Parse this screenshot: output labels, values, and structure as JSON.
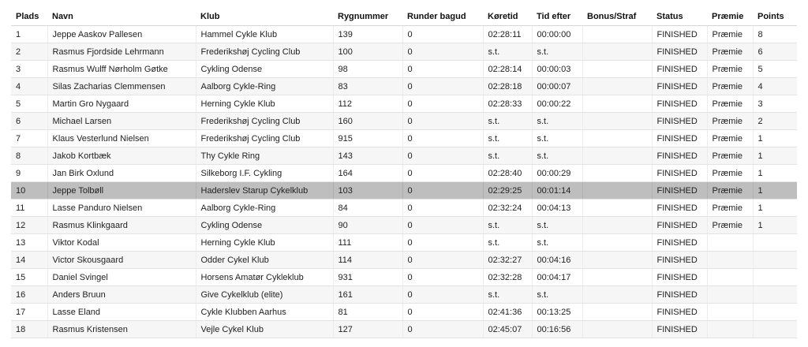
{
  "colors": {
    "highlight_row": "#bebebe",
    "stripe_row": "#f6f6f6",
    "border": "#e4e4e4"
  },
  "highlighted_rank": "10",
  "table": {
    "columns": [
      "Plads",
      "Navn",
      "Klub",
      "Rygnummer",
      "Runder bagud",
      "Køretid",
      "Tid efter",
      "Bonus/Straf",
      "Status",
      "Præmie",
      "Points"
    ],
    "rows": [
      [
        "1",
        "Jeppe Aaskov Pallesen",
        "Hammel Cykle Klub",
        "139",
        "0",
        "02:28:11",
        "00:00:00",
        "",
        "FINISHED",
        "Præmie",
        "8"
      ],
      [
        "2",
        "Rasmus Fjordside Lehrmann",
        "Frederikshøj Cycling Club",
        "100",
        "0",
        "s.t.",
        "s.t.",
        "",
        "FINISHED",
        "Præmie",
        "6"
      ],
      [
        "3",
        "Rasmus Wulff Nørholm Gøtke",
        "Cykling Odense",
        "98",
        "0",
        "02:28:14",
        "00:00:03",
        "",
        "FINISHED",
        "Præmie",
        "5"
      ],
      [
        "4",
        "Silas Zacharias Clemmensen",
        "Aalborg Cykle-Ring",
        "83",
        "0",
        "02:28:18",
        "00:00:07",
        "",
        "FINISHED",
        "Præmie",
        "4"
      ],
      [
        "5",
        "Martin Gro Nygaard",
        "Herning Cykle Klub",
        "112",
        "0",
        "02:28:33",
        "00:00:22",
        "",
        "FINISHED",
        "Præmie",
        "3"
      ],
      [
        "6",
        "Michael Larsen",
        "Frederikshøj Cycling Club",
        "160",
        "0",
        "s.t.",
        "s.t.",
        "",
        "FINISHED",
        "Præmie",
        "2"
      ],
      [
        "7",
        "Klaus Vesterlund Nielsen",
        "Frederikshøj Cycling Club",
        "915",
        "0",
        "s.t.",
        "s.t.",
        "",
        "FINISHED",
        "Præmie",
        "1"
      ],
      [
        "8",
        "Jakob Kortbæk",
        "Thy Cykle Ring",
        "143",
        "0",
        "s.t.",
        "s.t.",
        "",
        "FINISHED",
        "Præmie",
        "1"
      ],
      [
        "9",
        "Jan Birk Oxlund",
        "Silkeborg I.F. Cykling",
        "164",
        "0",
        "02:28:40",
        "00:00:29",
        "",
        "FINISHED",
        "Præmie",
        "1"
      ],
      [
        "10",
        "Jeppe Tolbøll",
        "Haderslev Starup Cykelklub",
        "103",
        "0",
        "02:29:25",
        "00:01:14",
        "",
        "FINISHED",
        "Præmie",
        "1"
      ],
      [
        "11",
        "Lasse Panduro Nielsen",
        "Aalborg Cykle-Ring",
        "84",
        "0",
        "02:32:24",
        "00:04:13",
        "",
        "FINISHED",
        "Præmie",
        "1"
      ],
      [
        "12",
        "Rasmus Klinkgaard",
        "Cykling Odense",
        "90",
        "0",
        "s.t.",
        "s.t.",
        "",
        "FINISHED",
        "Præmie",
        "1"
      ],
      [
        "13",
        "Viktor Kodal",
        "Herning Cykle Klub",
        "111",
        "0",
        "s.t.",
        "s.t.",
        "",
        "FINISHED",
        "",
        ""
      ],
      [
        "14",
        "Victor Skousgaard",
        "Odder Cykel Klub",
        "114",
        "0",
        "02:32:27",
        "00:04:16",
        "",
        "FINISHED",
        "",
        ""
      ],
      [
        "15",
        "Daniel Svingel",
        "Horsens Amatør Cykleklub",
        "931",
        "0",
        "02:32:28",
        "00:04:17",
        "",
        "FINISHED",
        "",
        ""
      ],
      [
        "16",
        "Anders Bruun",
        "Give Cykelklub (elite)",
        "161",
        "0",
        "s.t.",
        "s.t.",
        "",
        "FINISHED",
        "",
        ""
      ],
      [
        "17",
        "Lasse Eland",
        "Cykle Klubben Aarhus",
        "81",
        "0",
        "02:41:36",
        "00:13:25",
        "",
        "FINISHED",
        "",
        ""
      ],
      [
        "18",
        "Rasmus Kristensen",
        "Vejle Cykel Klub",
        "127",
        "0",
        "02:45:07",
        "00:16:56",
        "",
        "FINISHED",
        "",
        ""
      ]
    ]
  }
}
